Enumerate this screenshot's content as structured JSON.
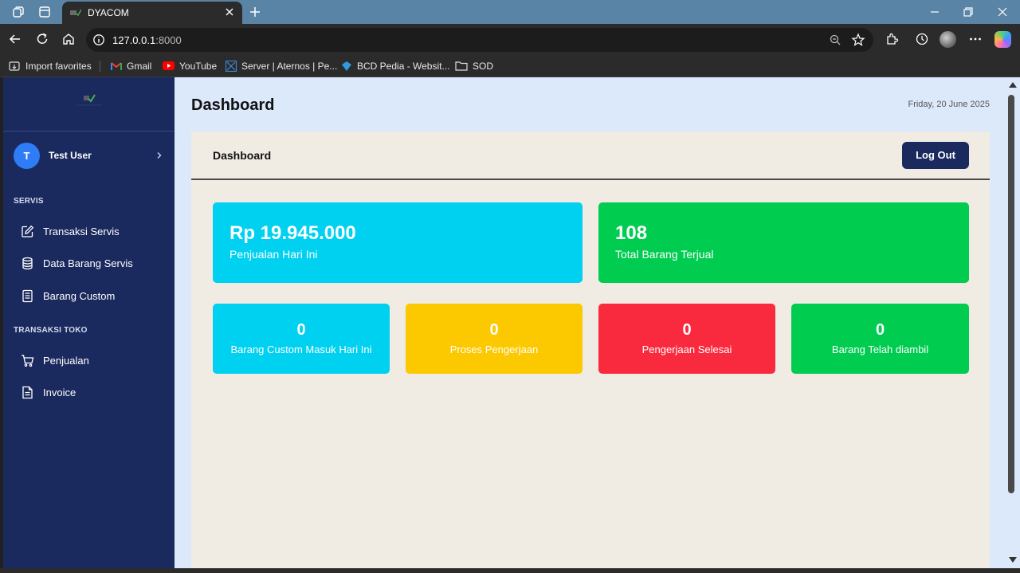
{
  "browser": {
    "tab_title": "DYACOM",
    "url_host": "127.0.0.1",
    "url_port": ":8000",
    "bookmarks": [
      "Import favorites",
      "Gmail",
      "YouTube",
      "Server | Aternos | Pe...",
      "BCD Pedia - Websit...",
      "SOD"
    ]
  },
  "sidebar": {
    "user": {
      "initial": "T",
      "name": "Test User"
    },
    "sections": [
      {
        "title": "SERVIS",
        "items": [
          {
            "label": "Transaksi Servis",
            "icon": "edit-icon"
          },
          {
            "label": "Data Barang Servis",
            "icon": "database-icon"
          },
          {
            "label": "Barang Custom",
            "icon": "document-list-icon"
          }
        ]
      },
      {
        "title": "TRANSAKSI TOKO",
        "items": [
          {
            "label": "Penjualan",
            "icon": "cart-icon"
          },
          {
            "label": "Invoice",
            "icon": "invoice-icon"
          }
        ]
      }
    ]
  },
  "header": {
    "title": "Dashboard",
    "date": "Friday, 20 June 2025"
  },
  "panel": {
    "title": "Dashboard",
    "logout_label": "Log Out"
  },
  "stats_large": [
    {
      "value": "Rp 19.945.000",
      "label": "Penjualan Hari Ini",
      "color": "#00d1f0"
    },
    {
      "value": "108",
      "label": "Total Barang Terjual",
      "color": "#00cc50"
    }
  ],
  "stats_small": [
    {
      "value": "0",
      "label": "Barang Custom Masuk Hari Ini",
      "color": "#00d1f0"
    },
    {
      "value": "0",
      "label": "Proses Pengerjaan",
      "color": "#fcc800"
    },
    {
      "value": "0",
      "label": "Pengerjaan Selesai",
      "color": "#fa2a3e"
    },
    {
      "value": "0",
      "label": "Barang Telah diambil",
      "color": "#00cc50"
    }
  ],
  "colors": {
    "sidebar": "#1b2a5e",
    "page_bg": "#dce9fb",
    "panel_bg": "#f0ebe3",
    "accent": "#2e7cf6"
  }
}
